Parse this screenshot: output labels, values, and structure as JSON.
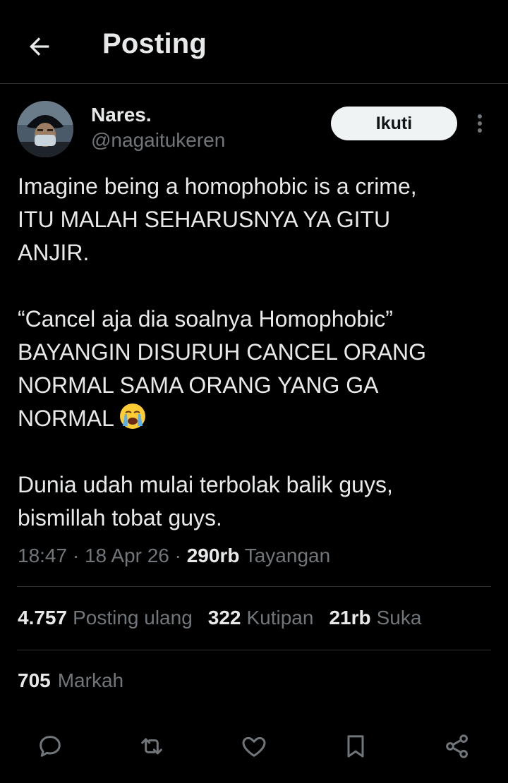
{
  "header": {
    "title": "Posting",
    "back_icon": "arrow-left-icon"
  },
  "author": {
    "name": "Nares.",
    "handle": "@nagaitukeren",
    "avatar_icon": "avatar-photo"
  },
  "follow_label": "Ikuti",
  "more_icon": "more-vertical-icon",
  "tweet": {
    "paragraph_1": "Imagine being a homophobic is a crime,\nITU MALAH SEHARUSNYA YA GITU\nANJIR.",
    "paragraph_2": "“Cancel aja dia soalnya Homophobic”\nBAYANGIN DISURUH CANCEL ORANG\nNORMAL SAMA ORANG YANG GA\nNORMAL",
    "paragraph_2_emoji": "loudly-crying-face-emoji",
    "paragraph_3": "Dunia udah mulai terbolak balik guys,\nbismillah tobat guys."
  },
  "meta": {
    "time": "18:47",
    "date": "18 Apr 26",
    "separator": " · ",
    "views_count": "290rb",
    "views_label": "Tayangan"
  },
  "stats": {
    "reposts_count": "4.757",
    "reposts_label": "Posting ulang",
    "quotes_count": "322",
    "quotes_label": "Kutipan",
    "likes_count": "21rb",
    "likes_label": "Suka",
    "bookmarks_count": "705",
    "bookmarks_label": "Markah"
  },
  "actions": [
    "reply-icon",
    "repost-icon",
    "like-icon",
    "bookmark-icon",
    "share-icon"
  ],
  "colors": {
    "background": "#000000",
    "text_primary": "#e7e9ea",
    "text_secondary": "#71767b",
    "divider": "#2f3336",
    "follow_button_bg": "#eff3f4",
    "follow_button_text": "#0f1419"
  }
}
